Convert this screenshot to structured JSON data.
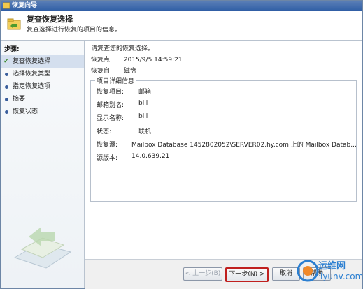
{
  "window": {
    "title": "恢复向导"
  },
  "header": {
    "title": "复查恢复选择",
    "description": "复查选择进行恢复的项目的信息。"
  },
  "sidebar": {
    "label": "步骤:",
    "items": [
      {
        "label": "复查恢复选择",
        "active": true
      },
      {
        "label": "选择恢复类型"
      },
      {
        "label": "指定恢复选项"
      },
      {
        "label": "摘要"
      },
      {
        "label": "恢复状态"
      }
    ]
  },
  "content": {
    "intro": "请复查您的恢复选择。",
    "restore_point_label": "恢复点:",
    "restore_point_value": "2015/9/5 14:59:21",
    "restore_from_label": "恢复自:",
    "restore_from_value": "磁盘",
    "group_title": "项目详细信息",
    "details": [
      {
        "label": "恢复项目:",
        "value": "邮箱"
      },
      {
        "label": "邮箱别名:",
        "value": "bill"
      },
      {
        "label": "显示名称:",
        "value": "bill"
      },
      {
        "label": "状态:",
        "value": "联机"
      },
      {
        "label": "恢复源:",
        "value": "Mailbox Database 1452802052\\SERVER02.hy.com 上的 Mailbox Datab..."
      },
      {
        "label": "源版本:",
        "value": "14.0.639.21"
      }
    ]
  },
  "footer": {
    "back_label": "< 上一步(B)",
    "next_label": "下一步(N) >",
    "cancel_label": "取消",
    "help_label": "帮助"
  },
  "watermark": {
    "text": "运维网",
    "sub": "iyunv.com"
  },
  "colors": {
    "titlebar": "#2f5ea5",
    "highlight": "#c0201e",
    "accent": "#3a5e9c"
  }
}
